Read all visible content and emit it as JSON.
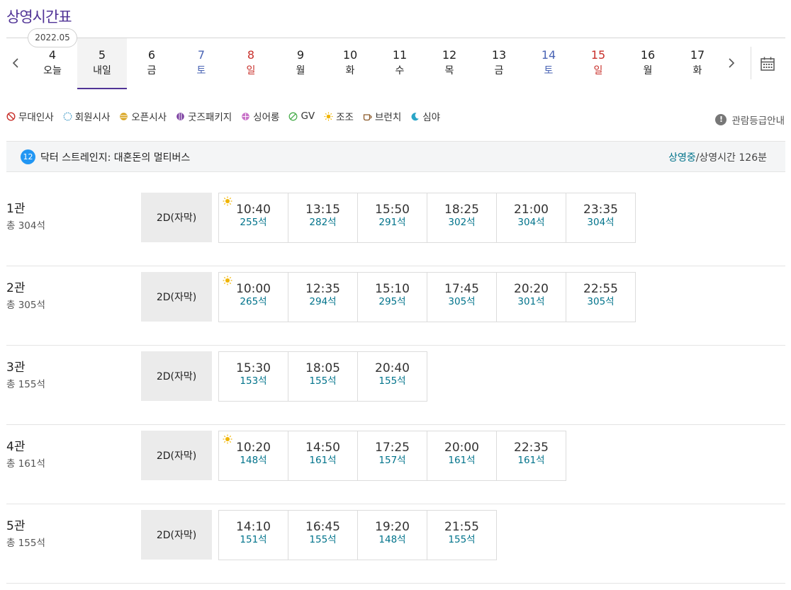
{
  "page_title": "상영시간표",
  "month_label": "2022.05",
  "dates": [
    {
      "num": "4",
      "dow": "오늘",
      "tone": "normal",
      "active": false
    },
    {
      "num": "5",
      "dow": "내일",
      "tone": "normal",
      "active": true
    },
    {
      "num": "6",
      "dow": "금",
      "tone": "normal",
      "active": false
    },
    {
      "num": "7",
      "dow": "토",
      "tone": "sat",
      "active": false
    },
    {
      "num": "8",
      "dow": "일",
      "tone": "sun",
      "active": false
    },
    {
      "num": "9",
      "dow": "월",
      "tone": "normal",
      "active": false
    },
    {
      "num": "10",
      "dow": "화",
      "tone": "normal",
      "active": false
    },
    {
      "num": "11",
      "dow": "수",
      "tone": "normal",
      "active": false
    },
    {
      "num": "12",
      "dow": "목",
      "tone": "normal",
      "active": false
    },
    {
      "num": "13",
      "dow": "금",
      "tone": "normal",
      "active": false
    },
    {
      "num": "14",
      "dow": "토",
      "tone": "sat",
      "active": false
    },
    {
      "num": "15",
      "dow": "일",
      "tone": "sun",
      "active": false
    },
    {
      "num": "16",
      "dow": "월",
      "tone": "normal",
      "active": false
    },
    {
      "num": "17",
      "dow": "화",
      "tone": "normal",
      "active": false
    }
  ],
  "legend": [
    {
      "label": "무대인사",
      "icon": "no-entry-icon"
    },
    {
      "label": "회원시사",
      "icon": "dotted-circle-icon"
    },
    {
      "label": "오픈시사",
      "icon": "striped-circle-icon"
    },
    {
      "label": "굿즈패키지",
      "icon": "vertical-stripe-circle-icon"
    },
    {
      "label": "싱어롱",
      "icon": "grid-circle-icon"
    },
    {
      "label": "GV",
      "icon": "slash-circle-icon"
    },
    {
      "label": "조조",
      "icon": "sun-icon"
    },
    {
      "label": "브런치",
      "icon": "coffee-cup-icon"
    },
    {
      "label": "심야",
      "icon": "moon-icon"
    }
  ],
  "rating_guide": "관람등급안내",
  "movie": {
    "age": "12",
    "title": "닥터 스트레인지: 대혼돈의 멀티버스",
    "status": "상영중",
    "runtime": "/상영시간 126분"
  },
  "halls": [
    {
      "name": "1관",
      "seats": "총 304석",
      "format": "2D(자막)",
      "times": [
        {
          "time": "10:40",
          "seats": "255석",
          "morning": true
        },
        {
          "time": "13:15",
          "seats": "282석",
          "morning": false
        },
        {
          "time": "15:50",
          "seats": "291석",
          "morning": false
        },
        {
          "time": "18:25",
          "seats": "302석",
          "morning": false
        },
        {
          "time": "21:00",
          "seats": "304석",
          "morning": false
        },
        {
          "time": "23:35",
          "seats": "304석",
          "morning": false
        }
      ]
    },
    {
      "name": "2관",
      "seats": "총 305석",
      "format": "2D(자막)",
      "times": [
        {
          "time": "10:00",
          "seats": "265석",
          "morning": true
        },
        {
          "time": "12:35",
          "seats": "294석",
          "morning": false
        },
        {
          "time": "15:10",
          "seats": "295석",
          "morning": false
        },
        {
          "time": "17:45",
          "seats": "305석",
          "morning": false
        },
        {
          "time": "20:20",
          "seats": "301석",
          "morning": false
        },
        {
          "time": "22:55",
          "seats": "305석",
          "morning": false
        }
      ]
    },
    {
      "name": "3관",
      "seats": "총 155석",
      "format": "2D(자막)",
      "times": [
        {
          "time": "15:30",
          "seats": "153석",
          "morning": false
        },
        {
          "time": "18:05",
          "seats": "155석",
          "morning": false
        },
        {
          "time": "20:40",
          "seats": "155석",
          "morning": false
        }
      ]
    },
    {
      "name": "4관",
      "seats": "총 161석",
      "format": "2D(자막)",
      "times": [
        {
          "time": "10:20",
          "seats": "148석",
          "morning": true
        },
        {
          "time": "14:50",
          "seats": "161석",
          "morning": false
        },
        {
          "time": "17:25",
          "seats": "157석",
          "morning": false
        },
        {
          "time": "20:00",
          "seats": "161석",
          "morning": false
        },
        {
          "time": "22:35",
          "seats": "161석",
          "morning": false
        }
      ]
    },
    {
      "name": "5관",
      "seats": "총 155석",
      "format": "2D(자막)",
      "times": [
        {
          "time": "14:10",
          "seats": "151석",
          "morning": false
        },
        {
          "time": "16:45",
          "seats": "155석",
          "morning": false
        },
        {
          "time": "19:20",
          "seats": "148석",
          "morning": false
        },
        {
          "time": "21:55",
          "seats": "155석",
          "morning": false
        }
      ]
    }
  ],
  "colors": {
    "brand": "#503396",
    "seat_text": "#01738b",
    "saturday": "#4a64b4",
    "sunday": "#c8302b",
    "age12": "#2196f3"
  }
}
